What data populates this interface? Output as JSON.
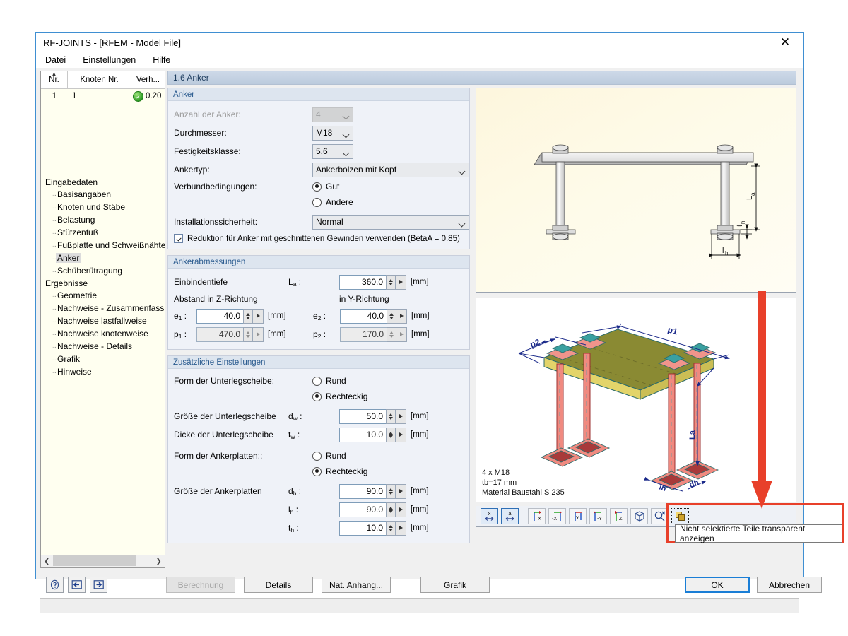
{
  "window": {
    "title": "RF-JOINTS - [RFEM - Model File]",
    "close_icon": "close-icon",
    "menu": [
      "Datei",
      "Einstellungen",
      "Hilfe"
    ]
  },
  "left_pane": {
    "grid": {
      "columns": [
        "Nr.",
        "Knoten Nr.",
        "Verh..."
      ],
      "rows": [
        {
          "nr": "1",
          "knoten": "1",
          "status_icon": "check-circle-icon",
          "verh": "0.20"
        }
      ]
    },
    "tree": [
      {
        "label": "Eingabedaten",
        "level": 0,
        "selected": false
      },
      {
        "label": "Basisangaben",
        "level": 1,
        "selected": false
      },
      {
        "label": "Knoten und Stäbe",
        "level": 1,
        "selected": false
      },
      {
        "label": "Belastung",
        "level": 1,
        "selected": false
      },
      {
        "label": "Stützenfuß",
        "level": 1,
        "selected": false
      },
      {
        "label": "Fußplatte und Schweißnähte",
        "level": 1,
        "selected": false
      },
      {
        "label": "Anker",
        "level": 1,
        "selected": true
      },
      {
        "label": "Schüberütragung",
        "level": 1,
        "selected": false
      },
      {
        "label": "Ergebnisse",
        "level": 0,
        "selected": false
      },
      {
        "label": "Geometrie",
        "level": 1,
        "selected": false
      },
      {
        "label": "Nachweise - Zusammenfassung",
        "level": 1,
        "selected": false
      },
      {
        "label": "Nachweise lastfallweise",
        "level": 1,
        "selected": false
      },
      {
        "label": "Nachweise knotenweise",
        "level": 1,
        "selected": false
      },
      {
        "label": "Nachweise - Details",
        "level": 1,
        "selected": false
      },
      {
        "label": "Grafik",
        "level": 1,
        "selected": false
      },
      {
        "label": "Hinweise",
        "level": 1,
        "selected": false
      }
    ],
    "scroll_left_icon": "chevron-left-icon",
    "scroll_right_icon": "chevron-right-icon"
  },
  "section_title": "1.6 Anker",
  "groups": {
    "anker": {
      "title": "Anker",
      "anzahl_label": "Anzahl der Anker:",
      "anzahl_value": "4",
      "durchmesser_label": "Durchmesser:",
      "durchmesser_value": "M18",
      "festigkeit_label": "Festigkeitsklasse:",
      "festigkeit_value": "5.6",
      "ankertyp_label": "Ankertyp:",
      "ankertyp_value": "Ankerbolzen mit Kopf",
      "verbund_label": "Verbundbedingungen:",
      "verbund_options": [
        {
          "label": "Gut",
          "selected": true
        },
        {
          "label": "Andere",
          "selected": false
        }
      ],
      "install_label": "Installationssicherheit:",
      "install_value": "Normal",
      "reduktion_label": "Reduktion für Anker mit geschnittenen Gewinden verwenden (BetaA = 0.85)",
      "reduktion_checked": true
    },
    "abmessungen": {
      "title": "Ankerabmessungen",
      "einbindetiefe_label": "Einbindentiefe",
      "la_symbol": "L",
      "la_sub": "a",
      "la_value": "360.0",
      "la_unit": "[mm]",
      "abstand_z_label": "Abstand in Z-Richtung",
      "abstand_y_label": "in Y-Richtung",
      "e1_symbol": "e",
      "e1_sub": "1",
      "e1_value": "40.0",
      "e1_unit": "[mm]",
      "e2_symbol": "e",
      "e2_sub": "2",
      "e2_value": "40.0",
      "e2_unit": "[mm]",
      "p1_symbol": "p",
      "p1_sub": "1",
      "p1_value": "470.0",
      "p1_unit": "[mm]",
      "p2_symbol": "p",
      "p2_sub": "2",
      "p2_value": "170.0",
      "p2_unit": "[mm]"
    },
    "zusatz": {
      "title": "Zusätzliche Einstellungen",
      "form_unterleg_label": "Form der Unterlegscheibe:",
      "form_unterleg_options": [
        {
          "label": "Rund",
          "selected": false
        },
        {
          "label": "Rechteckig",
          "selected": true
        }
      ],
      "groesse_unterleg_label": "Größe der Unterlegscheibe",
      "dw_symbol": "d",
      "dw_sub": "w",
      "dw_value": "50.0",
      "dw_unit": "[mm]",
      "dicke_unterleg_label": "Dicke der Unterlegscheibe",
      "tw_symbol": "t",
      "tw_sub": "w",
      "tw_value": "10.0",
      "tw_unit": "[mm]",
      "form_ankerplatten_label": "Form der Ankerplatten::",
      "form_ankerplatten_options": [
        {
          "label": "Rund",
          "selected": false
        },
        {
          "label": "Rechteckig",
          "selected": true
        }
      ],
      "groesse_ankerplatten_label": "Größe der Ankerplatten",
      "dh_symbol": "d",
      "dh_sub": "h",
      "dh_value": "90.0",
      "dh_unit": "[mm]",
      "lh_symbol": "l",
      "lh_sub": "h",
      "lh_value": "90.0",
      "lh_unit": "[mm]",
      "th_symbol": "t",
      "th_sub": "h",
      "th_value": "10.0",
      "th_unit": "[mm]"
    }
  },
  "graphics": {
    "top_view_dimensions": [
      "La",
      "th",
      "lh"
    ],
    "model_info": "4 x M18\ntb=17 mm\nMaterial Baustahl S 235",
    "model_dimensions": [
      "p1",
      "p2",
      "La",
      "lh",
      "dh"
    ],
    "toolbar": [
      {
        "name": "fit-x-button",
        "label": "x",
        "active": true
      },
      {
        "name": "fit-a-button",
        "label": "a",
        "active": true
      },
      {
        "name": "view-x-button",
        "label": "X",
        "active": false
      },
      {
        "name": "view-minus-x-button",
        "label": "-X",
        "active": false
      },
      {
        "name": "view-y-button",
        "label": "Y",
        "active": false
      },
      {
        "name": "view-minus-y-button",
        "label": "-Y",
        "active": false
      },
      {
        "name": "view-z-button",
        "label": "Z",
        "active": false
      },
      {
        "name": "isometric-view-button",
        "label": "",
        "active": false
      },
      {
        "name": "zoom-tool-button",
        "label": "",
        "active": false
      },
      {
        "name": "transparent-parts-button",
        "label": "",
        "active": false
      }
    ]
  },
  "tooltip": {
    "text": "Nicht selektierte Teile transparent anzeigen"
  },
  "bottom": {
    "help_icon": "question-mark-icon",
    "prev_icon": "previous-arrow-icon",
    "next_icon": "next-arrow-icon",
    "berechnung": "Berechnung",
    "details": "Details",
    "nat_anhang": "Nat. Anhang...",
    "grafik": "Grafik",
    "ok": "OK",
    "abbrechen": "Abbrechen"
  },
  "colors": {
    "accent": "#1a7ed6",
    "annotation": "#e8402a",
    "group_header": "#2a5b8f",
    "status_ok": "#2f9e25"
  }
}
